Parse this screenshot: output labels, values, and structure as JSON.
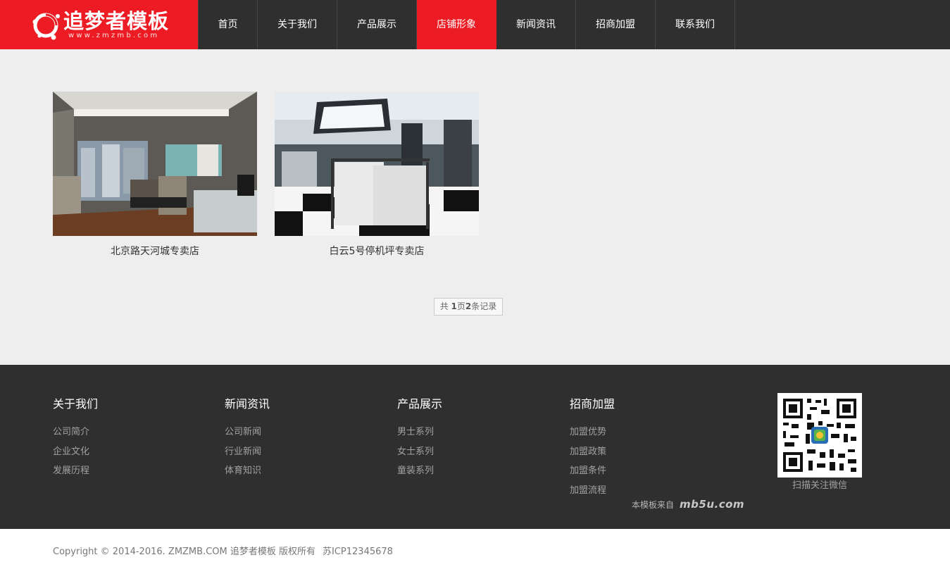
{
  "header": {
    "logo_text": "追梦者模板",
    "logo_sub": "www.zmzmb.com",
    "nav": [
      {
        "label": "首页",
        "active": false
      },
      {
        "label": "关于我们",
        "active": false
      },
      {
        "label": "产品展示",
        "active": false
      },
      {
        "label": "店铺形象",
        "active": true
      },
      {
        "label": "新闻资讯",
        "active": false
      },
      {
        "label": "招商加盟",
        "active": false
      },
      {
        "label": "联系我们",
        "active": false
      }
    ]
  },
  "main": {
    "stores": [
      {
        "title": "北京路天河城专卖店"
      },
      {
        "title": "白云5号停机坪专卖店"
      }
    ],
    "pager": {
      "prefix": "共 ",
      "pages": "1",
      "mid": "页",
      "records": "2",
      "suffix": "条记录"
    }
  },
  "footer": {
    "columns": [
      {
        "title": "关于我们",
        "links": [
          "公司简介",
          "企业文化",
          "发展历程"
        ]
      },
      {
        "title": "新闻资讯",
        "links": [
          "公司新闻",
          "行业新闻",
          "体育知识"
        ]
      },
      {
        "title": "产品展示",
        "links": [
          "男士系列",
          "女士系列",
          "童装系列"
        ]
      },
      {
        "title": "招商加盟",
        "links": [
          "加盟优势",
          "加盟政策",
          "加盟条件",
          "加盟流程"
        ]
      }
    ],
    "qr_caption": "扫描关注微信",
    "credit_text": "本模板来自",
    "credit_logo": "mb5u.com"
  },
  "bottom": {
    "copyright": "Copyright © 2014-2016. ZMZMB.COM 追梦者模板 版权所有",
    "icp": "苏ICP12345678"
  },
  "colors": {
    "brand_red": "#ed1c24",
    "dark": "#2f2f2f"
  }
}
